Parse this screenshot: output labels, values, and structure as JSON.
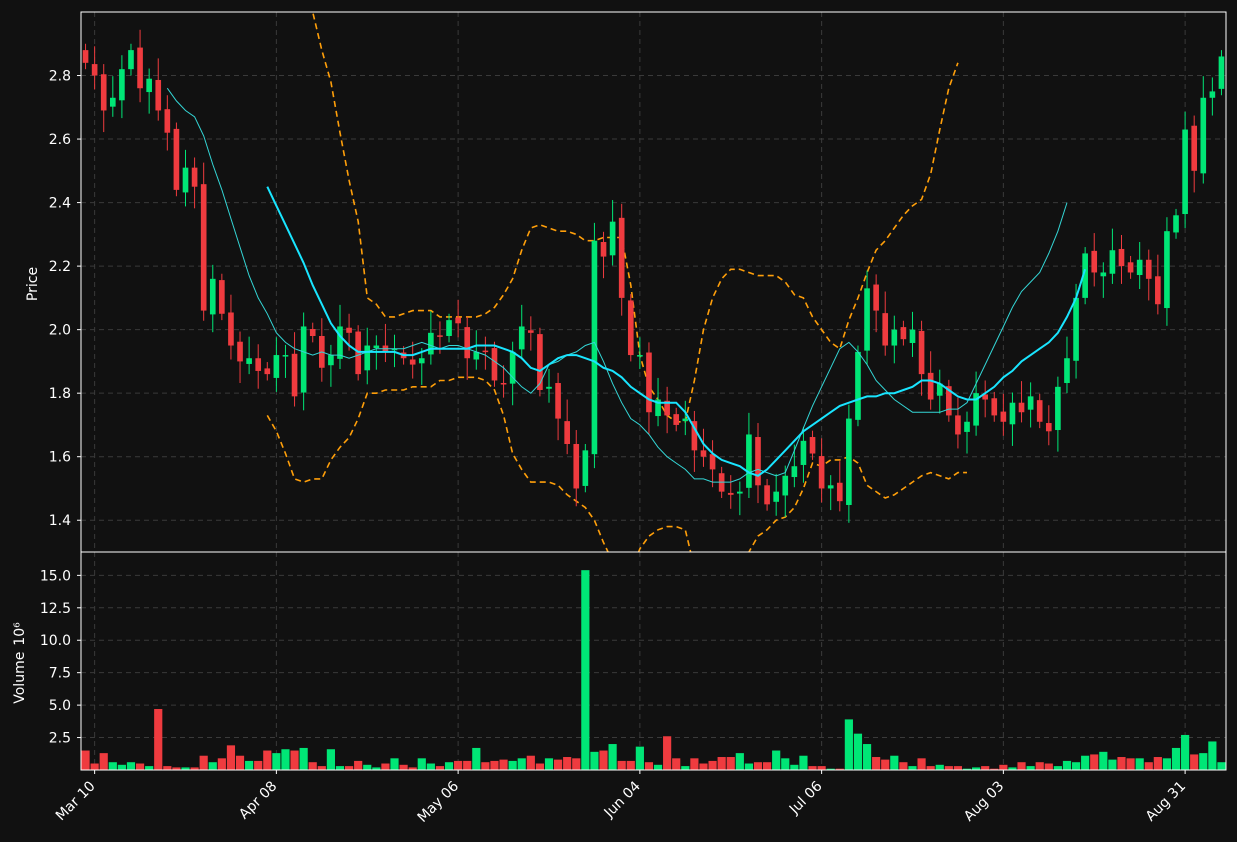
{
  "colors": {
    "background": "#111111",
    "axes_frame": "#ffffff",
    "up_candle": "#00e676",
    "down_candle": "#ef3b3f",
    "ma_fast": "#34d6d6",
    "ma_slow": "#19e5ff",
    "band": "#ff9f0a",
    "grid": "#3a3a3a"
  },
  "chart_data": {
    "type": "candlestick",
    "ylabel_price": "Price",
    "ylabel_volume": "Volume",
    "volume_multiplier": "10⁶",
    "price_ylim": [
      1.3,
      3.0
    ],
    "price_yticks": [
      "1.4",
      "1.6",
      "1.8",
      "2.0",
      "2.2",
      "2.4",
      "2.6",
      "2.8"
    ],
    "volume_ylim": [
      0,
      16.8
    ],
    "volume_yticks": [
      "2.5",
      "5.0",
      "7.5",
      "10.0",
      "12.5",
      "15.0"
    ],
    "xlim": [
      "2020-03-10",
      "2020-09-08"
    ],
    "xticks": [
      "Mar 10",
      "Apr 08",
      "May 06",
      "Jun 04",
      "Jul 06",
      "Aug 03",
      "Aug 31"
    ],
    "grid": true,
    "series_notes": "daily OHLC candles with two moving averages, a band (upper/lower) and a volume subplot",
    "closes": [
      2.84,
      2.8,
      2.69,
      2.73,
      2.82,
      2.88,
      2.76,
      2.79,
      2.69,
      2.62,
      2.44,
      2.51,
      2.45,
      2.06,
      2.16,
      2.05,
      1.95,
      1.9,
      1.91,
      1.87,
      1.86,
      1.92,
      1.92,
      1.79,
      2.01,
      1.98,
      1.88,
      1.92,
      2.01,
      1.99,
      1.86,
      1.95,
      1.95,
      1.93,
      1.94,
      1.91,
      1.89,
      1.91,
      1.99,
      1.98,
      2.03,
      2.02,
      1.91,
      1.93,
      1.93,
      1.84,
      1.83,
      1.93,
      2.01,
      1.99,
      1.81,
      1.82,
      1.72,
      1.64,
      1.5,
      1.62,
      2.28,
      2.23,
      2.34,
      2.1,
      1.92,
      1.92,
      1.74,
      1.78,
      1.73,
      1.7,
      1.72,
      1.62,
      1.6,
      1.56,
      1.49,
      1.48,
      1.49,
      1.67,
      1.51,
      1.45,
      1.49,
      1.54,
      1.57,
      1.65,
      1.61,
      1.5,
      1.51,
      1.46,
      1.72,
      1.93,
      2.13,
      2.06,
      1.95,
      2.0,
      1.97,
      2.0,
      1.86,
      1.78,
      1.83,
      1.73,
      1.67,
      1.71,
      1.8,
      1.78,
      1.73,
      1.71,
      1.77,
      1.74,
      1.79,
      1.71,
      1.68,
      1.82,
      1.91,
      2.1,
      2.24,
      2.18,
      2.18,
      2.25,
      2.2,
      2.18,
      2.22,
      2.16,
      2.08,
      2.31,
      2.36,
      2.63,
      2.5,
      2.73,
      2.75,
      2.86
    ],
    "volumes_millions": [
      1.5,
      0.5,
      1.3,
      0.6,
      0.4,
      0.6,
      0.5,
      0.3,
      4.7,
      0.3,
      0.2,
      0.2,
      0.2,
      1.1,
      0.6,
      0.9,
      1.9,
      1.1,
      0.7,
      0.7,
      1.5,
      1.3,
      1.6,
      1.5,
      1.7,
      0.6,
      0.3,
      1.6,
      0.3,
      0.3,
      0.7,
      0.4,
      0.2,
      0.5,
      0.9,
      0.4,
      0.2,
      0.9,
      0.5,
      0.3,
      0.6,
      0.7,
      0.7,
      1.7,
      0.6,
      0.7,
      0.8,
      0.7,
      0.9,
      1.1,
      0.5,
      0.9,
      0.8,
      1.0,
      0.9,
      15.4,
      1.4,
      1.5,
      2.0,
      0.7,
      0.7,
      1.8,
      0.6,
      0.4,
      2.6,
      0.9,
      0.3,
      0.9,
      0.5,
      0.7,
      1.0,
      1.0,
      1.3,
      0.5,
      0.6,
      0.6,
      1.5,
      0.9,
      0.4,
      1.1,
      0.3,
      0.3,
      0.1,
      0.1,
      3.9,
      2.8,
      2.0,
      1.0,
      0.8,
      1.1,
      0.6,
      0.3,
      0.9,
      0.3,
      0.4,
      0.3,
      0.3,
      0.1,
      0.2,
      0.3,
      0.1,
      0.4,
      0.2,
      0.6,
      0.3,
      0.6,
      0.5,
      0.3,
      0.7,
      0.6,
      1.1,
      1.2,
      1.4,
      0.8,
      1.0,
      0.9,
      0.9,
      0.6,
      1.0,
      0.9,
      1.7,
      2.7,
      1.2,
      1.3,
      2.2,
      0.6
    ],
    "ma_fast": [
      2.76,
      2.72,
      2.69,
      2.67,
      2.61,
      2.52,
      2.44,
      2.35,
      2.26,
      2.17,
      2.1,
      2.05,
      1.99,
      1.96,
      1.94,
      1.93,
      1.92,
      1.93,
      1.92,
      1.92,
      1.91,
      1.92,
      1.93,
      1.94,
      1.94,
      1.94,
      1.94,
      1.95,
      1.96,
      1.95,
      1.94,
      1.95,
      1.95,
      1.94,
      1.93,
      1.92,
      1.9,
      1.88,
      1.85,
      1.82,
      1.8,
      1.83,
      1.89,
      1.9,
      1.92,
      1.93,
      1.95,
      1.96,
      1.9,
      1.83,
      1.77,
      1.72,
      1.7,
      1.67,
      1.63,
      1.6,
      1.58,
      1.56,
      1.53,
      1.53,
      1.52,
      1.52,
      1.52,
      1.53,
      1.55,
      1.56,
      1.55,
      1.54,
      1.55,
      1.62,
      1.69,
      1.76,
      1.82,
      1.88,
      1.94,
      1.96,
      1.93,
      1.89,
      1.84,
      1.81,
      1.78,
      1.76,
      1.74,
      1.74,
      1.74,
      1.74,
      1.75,
      1.75,
      1.77,
      1.83,
      1.89,
      1.95,
      2.01,
      2.07,
      2.12,
      2.15,
      2.18,
      2.24,
      2.31,
      2.4
    ],
    "ma_fast_start_index": 9,
    "ma_slow": [
      2.45,
      2.39,
      2.33,
      2.27,
      2.21,
      2.14,
      2.08,
      2.02,
      1.98,
      1.95,
      1.93,
      1.93,
      1.93,
      1.93,
      1.93,
      1.92,
      1.92,
      1.93,
      1.94,
      1.94,
      1.94,
      1.94,
      1.94,
      1.95,
      1.95,
      1.95,
      1.94,
      1.93,
      1.91,
      1.88,
      1.87,
      1.89,
      1.91,
      1.92,
      1.92,
      1.91,
      1.9,
      1.88,
      1.87,
      1.85,
      1.82,
      1.8,
      1.78,
      1.77,
      1.77,
      1.77,
      1.74,
      1.69,
      1.64,
      1.61,
      1.59,
      1.58,
      1.57,
      1.55,
      1.54,
      1.56,
      1.59,
      1.62,
      1.65,
      1.68,
      1.7,
      1.72,
      1.74,
      1.76,
      1.77,
      1.78,
      1.79,
      1.79,
      1.8,
      1.8,
      1.81,
      1.82,
      1.84,
      1.84,
      1.83,
      1.81,
      1.79,
      1.78,
      1.78,
      1.8,
      1.82,
      1.85,
      1.87,
      1.9,
      1.92,
      1.94,
      1.96,
      1.99,
      2.04,
      2.1,
      2.19
    ],
    "ma_slow_start_index": 20,
    "band_upper": [
      3.05,
      3.0,
      2.88,
      2.78,
      2.62,
      2.47,
      2.34,
      2.1,
      2.08,
      2.04,
      2.04,
      2.05,
      2.06,
      2.06,
      2.06,
      2.04,
      2.04,
      2.04,
      2.04,
      2.04,
      2.05,
      2.07,
      2.11,
      2.16,
      2.25,
      2.32,
      2.33,
      2.32,
      2.31,
      2.31,
      2.3,
      2.28,
      2.28,
      2.29,
      2.29,
      2.29,
      2.14,
      1.92,
      1.82,
      1.78,
      1.73,
      1.71,
      1.71,
      1.84,
      2.0,
      2.1,
      2.16,
      2.19,
      2.19,
      2.18,
      2.17,
      2.17,
      2.17,
      2.15,
      2.11,
      2.1,
      2.04,
      2.0,
      1.96,
      1.94,
      2.03,
      2.1,
      2.18,
      2.25,
      2.28,
      2.32,
      2.36,
      2.39,
      2.41,
      2.49,
      2.63,
      2.76,
      2.84
    ],
    "band_upper_start_index": 24,
    "band_lower": [
      1.73,
      1.68,
      1.61,
      1.53,
      1.52,
      1.53,
      1.53,
      1.59,
      1.63,
      1.66,
      1.72,
      1.8,
      1.8,
      1.81,
      1.81,
      1.81,
      1.82,
      1.82,
      1.82,
      1.84,
      1.84,
      1.85,
      1.85,
      1.85,
      1.84,
      1.81,
      1.73,
      1.61,
      1.56,
      1.52,
      1.52,
      1.52,
      1.51,
      1.48,
      1.46,
      1.44,
      1.4,
      1.33,
      1.27,
      1.23,
      1.24,
      1.31,
      1.35,
      1.37,
      1.38,
      1.38,
      1.37,
      1.25,
      1.19,
      1.16,
      1.17,
      1.21,
      1.25,
      1.3,
      1.35,
      1.37,
      1.4,
      1.41,
      1.44,
      1.5,
      1.58,
      1.57,
      1.59,
      1.59,
      1.6,
      1.58,
      1.51,
      1.49,
      1.47,
      1.48,
      1.5,
      1.52,
      1.54,
      1.55,
      1.54,
      1.53,
      1.55,
      1.55
    ],
    "band_lower_start_index": 20
  }
}
